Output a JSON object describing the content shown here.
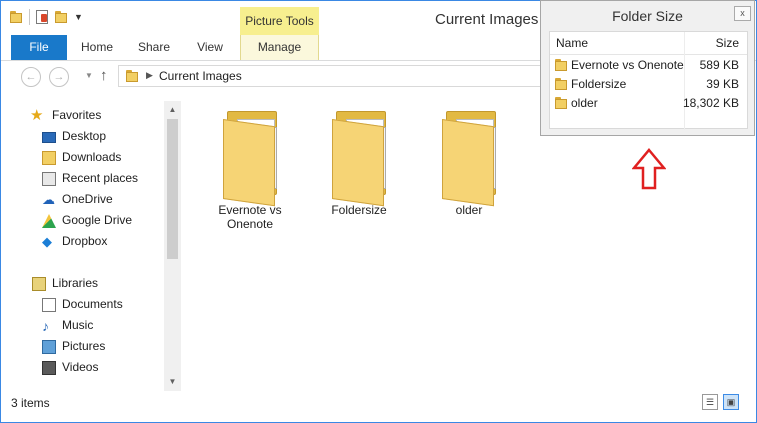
{
  "window": {
    "title": "Current Images",
    "contextual_group": "Picture Tools"
  },
  "ribbon": {
    "tabs": [
      {
        "label": "File"
      },
      {
        "label": "Home"
      },
      {
        "label": "Share"
      },
      {
        "label": "View"
      },
      {
        "label": "Manage"
      }
    ]
  },
  "address": {
    "crumb": "Current Images"
  },
  "nav_pane": {
    "favorites_label": "Favorites",
    "favorites": [
      {
        "label": "Desktop",
        "icon": "desktop-icon"
      },
      {
        "label": "Downloads",
        "icon": "downloads-icon"
      },
      {
        "label": "Recent places",
        "icon": "recent-places-icon"
      },
      {
        "label": "OneDrive",
        "icon": "onedrive-icon"
      },
      {
        "label": "Google Drive",
        "icon": "google-drive-icon"
      },
      {
        "label": "Dropbox",
        "icon": "dropbox-icon"
      }
    ],
    "libraries_label": "Libraries",
    "libraries": [
      {
        "label": "Documents",
        "icon": "documents-icon"
      },
      {
        "label": "Music",
        "icon": "music-icon"
      },
      {
        "label": "Pictures",
        "icon": "pictures-icon"
      },
      {
        "label": "Videos",
        "icon": "videos-icon"
      }
    ]
  },
  "content": {
    "folders": [
      {
        "line1": "Evernote vs",
        "line2": "Onenote"
      },
      {
        "line1": "Foldersize",
        "line2": ""
      },
      {
        "line1": "older",
        "line2": ""
      }
    ]
  },
  "status": {
    "items": "3 items"
  },
  "folder_size": {
    "title": "Folder Size",
    "close": "x",
    "headers": {
      "name": "Name",
      "size": "Size"
    },
    "rows": [
      {
        "name": "Evernote vs Onenote",
        "size": "589 KB"
      },
      {
        "name": "Foldersize",
        "size": "39 KB"
      },
      {
        "name": "older",
        "size": "18,302 KB"
      }
    ]
  },
  "colors": {
    "accent": "#1979ca",
    "context_tab": "#f7ef8f",
    "annotation_arrow": "#e02020"
  }
}
